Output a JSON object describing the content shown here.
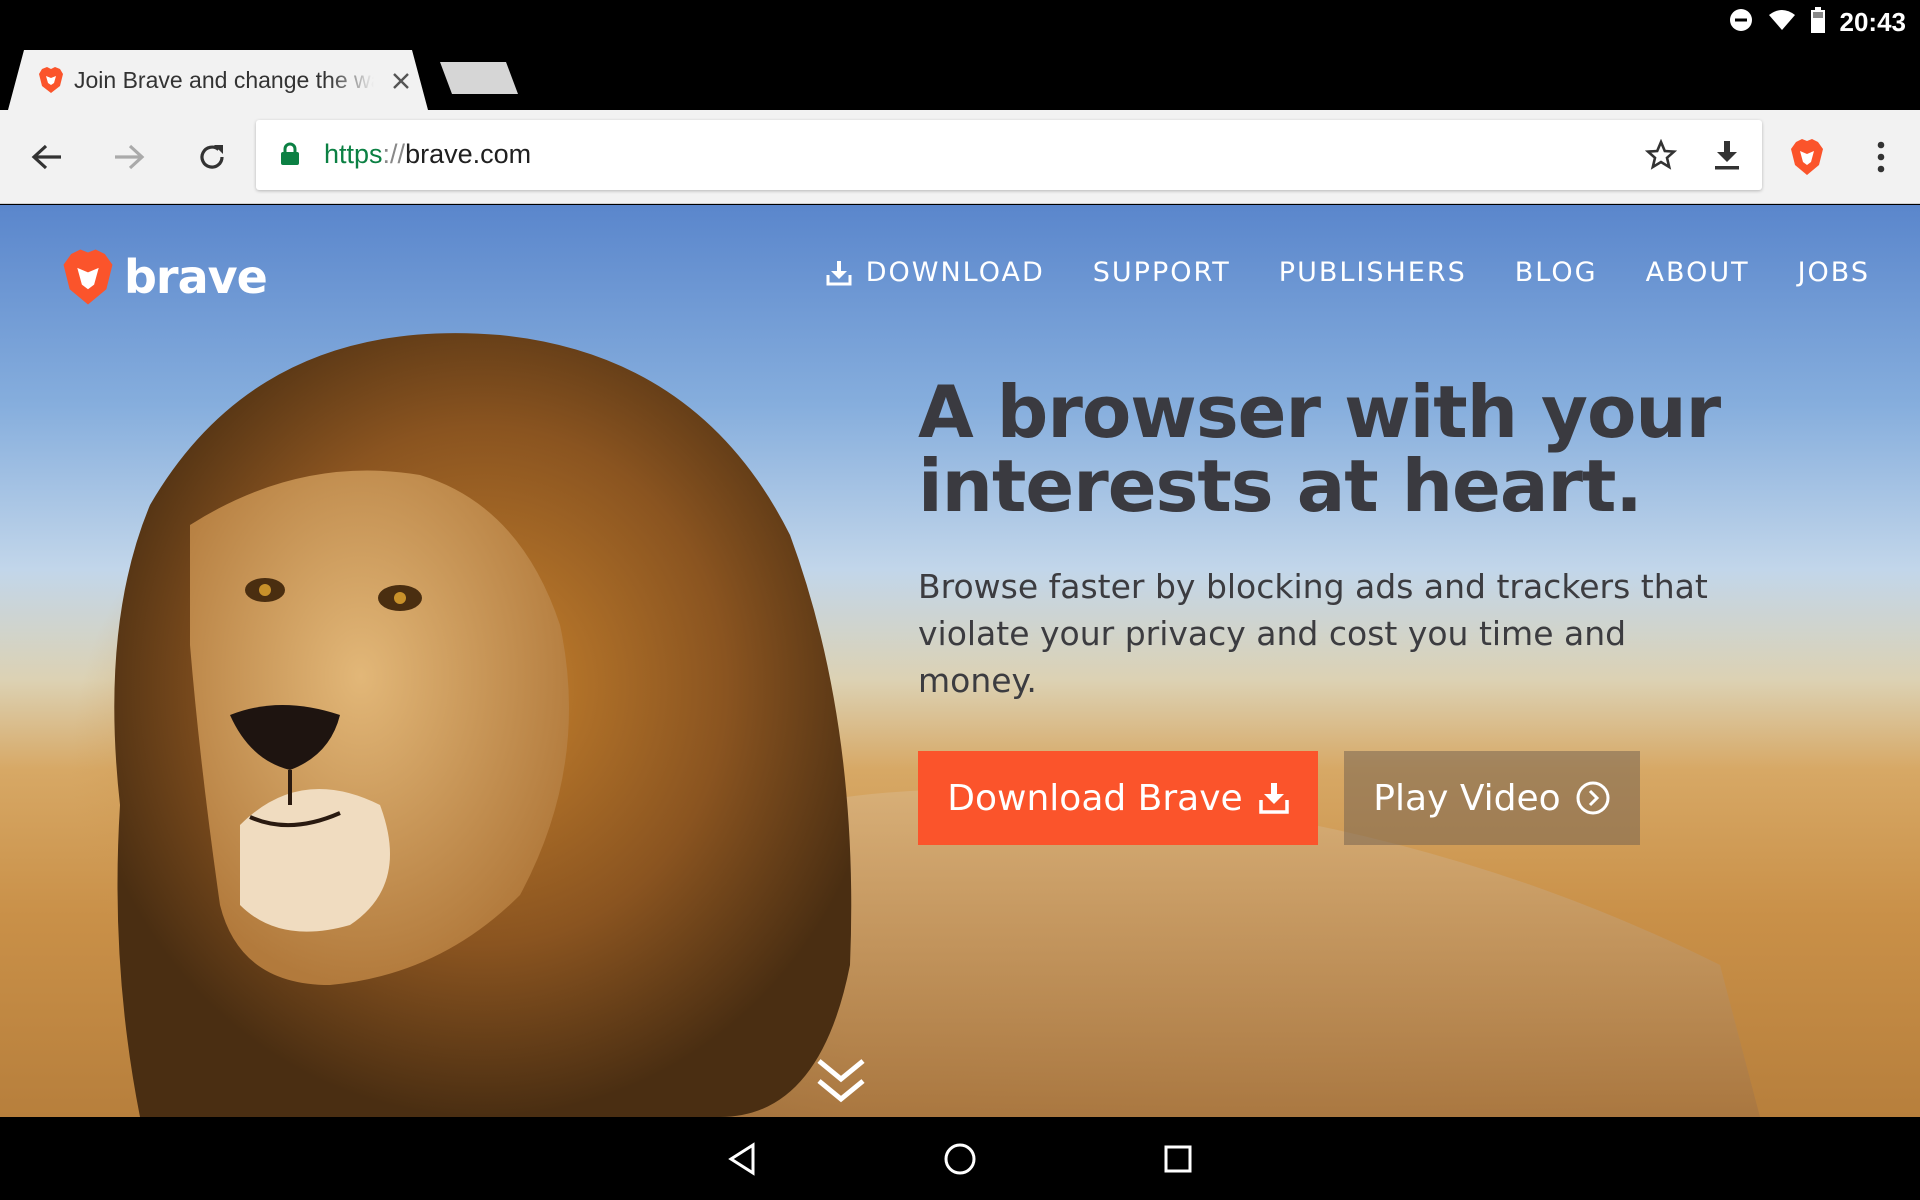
{
  "status_bar": {
    "time": "20:43"
  },
  "tab": {
    "title": "Join Brave and change the way you browse"
  },
  "omnibox": {
    "scheme": "https",
    "separator": "://",
    "host": "brave.com"
  },
  "site": {
    "logo_text": "brave",
    "nav": [
      "DOWNLOAD",
      "SUPPORT",
      "PUBLISHERS",
      "BLOG",
      "ABOUT",
      "JOBS"
    ],
    "headline_line1": "A browser with your",
    "headline_line2": "interests at heart.",
    "subtext": "Browse faster by blocking ads and trackers that violate your privacy and cost you time and money.",
    "download_button": "Download Brave",
    "video_button": "Play Video"
  },
  "colors": {
    "brand": "#fb542b",
    "secure": "#0b8043",
    "headline": "#3a3a40"
  }
}
